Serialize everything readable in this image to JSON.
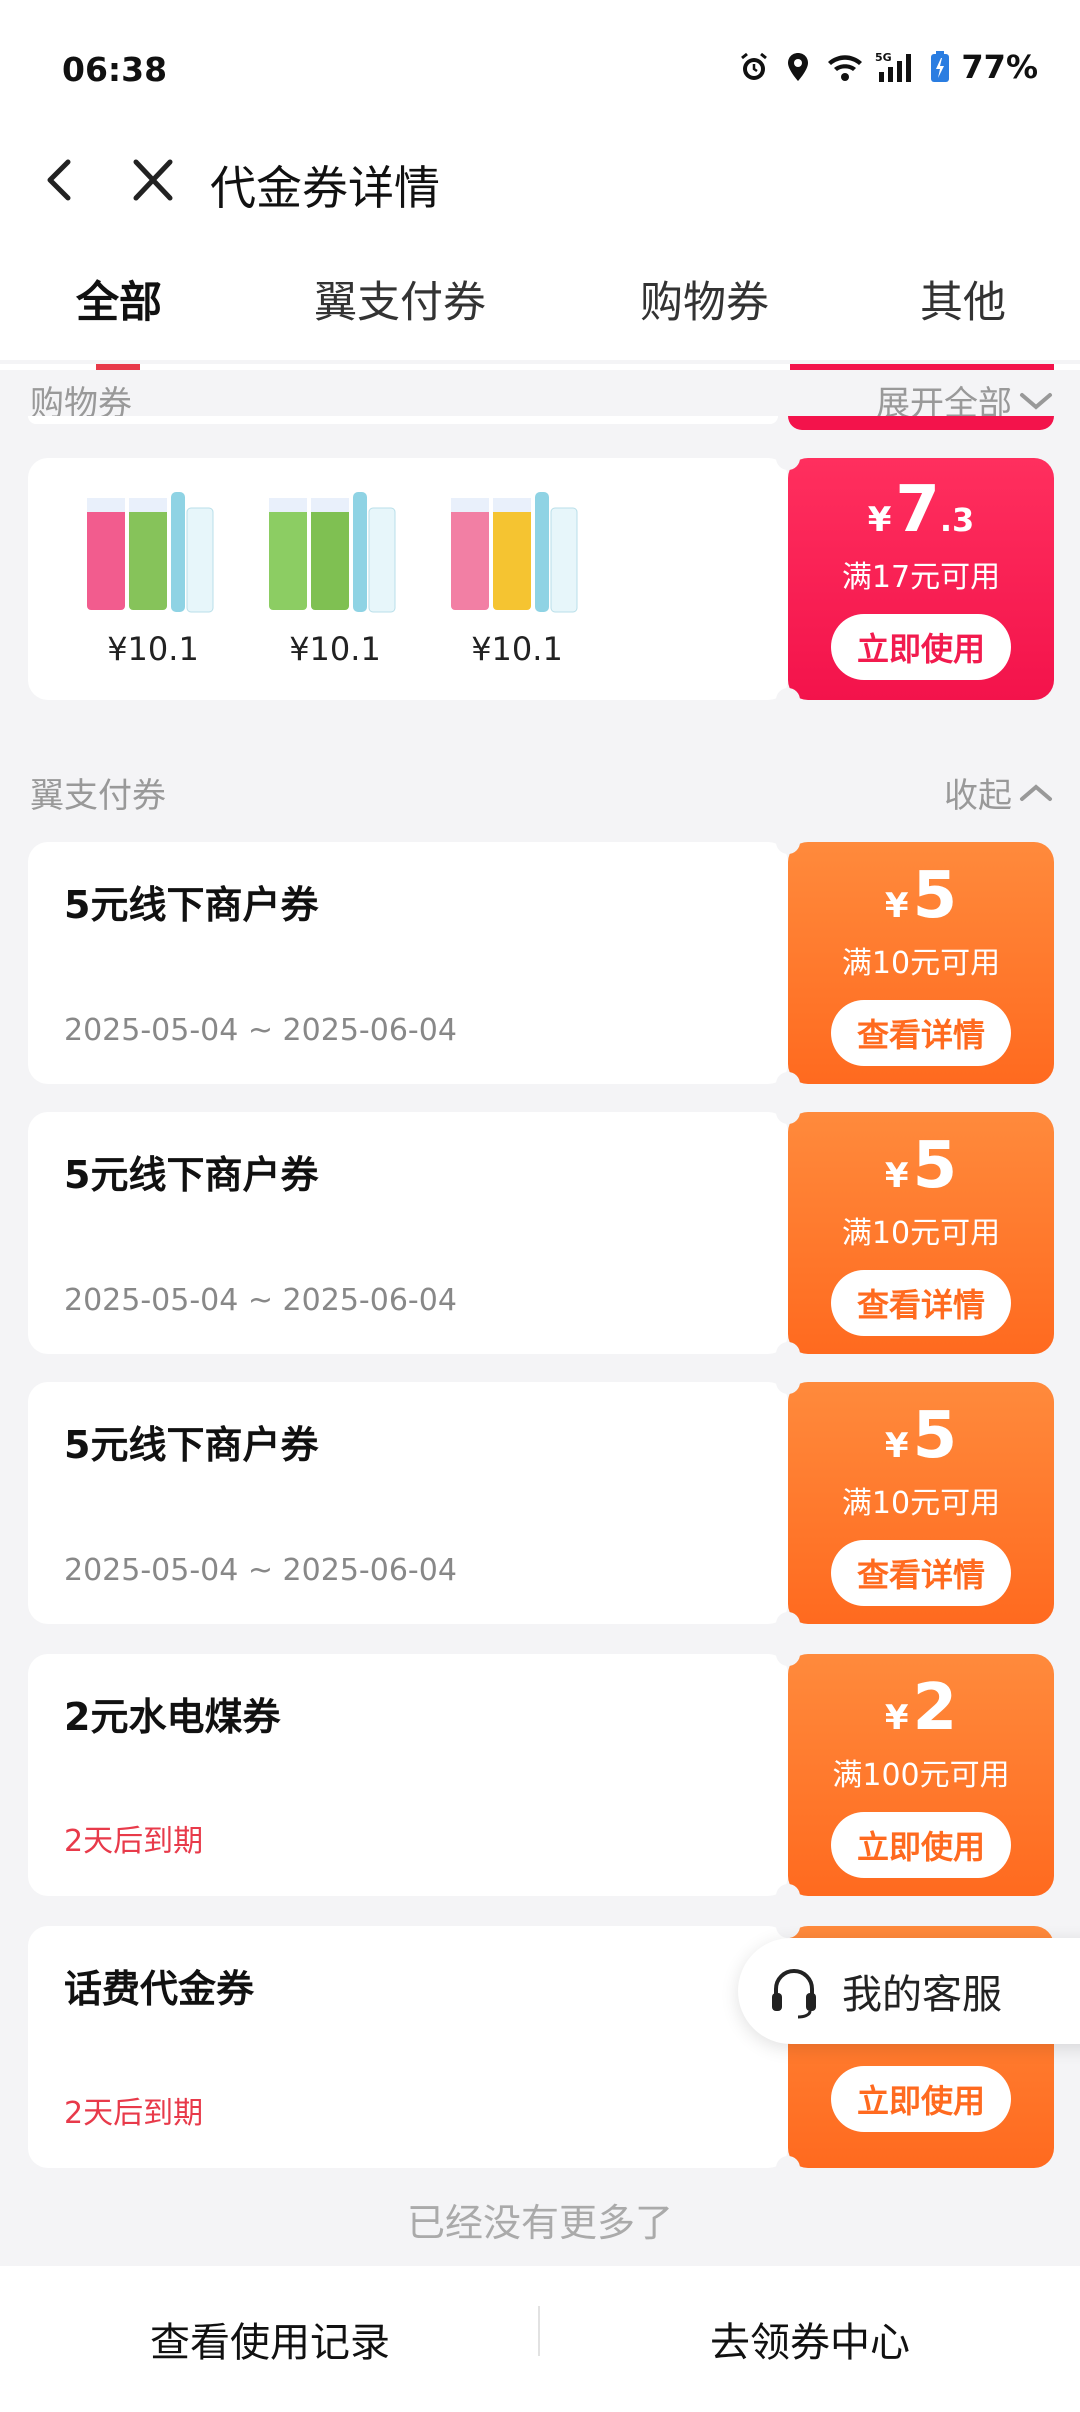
{
  "status": {
    "time": "06:38",
    "battery": "77%",
    "network": "5G"
  },
  "header": {
    "title": "代金券详情"
  },
  "tabs": [
    {
      "label": "全部",
      "active": true
    },
    {
      "label": "翼支付券",
      "active": false
    },
    {
      "label": "购物券",
      "active": false
    },
    {
      "label": "其他",
      "active": false
    }
  ],
  "shopping_section": {
    "label": "购物券",
    "action": "展开全部",
    "products": [
      {
        "price": "¥10.1"
      },
      {
        "price": "¥10.1"
      },
      {
        "price": "¥10.1"
      }
    ],
    "coupon": {
      "currency": "¥",
      "amount_int": "7",
      "amount_dec": ".3",
      "condition": "满17元可用",
      "button": "立即使用"
    }
  },
  "yzf_section": {
    "label": "翼支付券",
    "action": "收起",
    "coupons": [
      {
        "title": "5元线下商户券",
        "date": "2025-05-04 ~ 2025-06-04",
        "currency": "¥",
        "amount": "5",
        "condition": "满10元可用",
        "button": "查看详情"
      },
      {
        "title": "5元线下商户券",
        "date": "2025-05-04 ~ 2025-06-04",
        "currency": "¥",
        "amount": "5",
        "condition": "满10元可用",
        "button": "查看详情"
      },
      {
        "title": "5元线下商户券",
        "date": "2025-05-04 ~ 2025-06-04",
        "currency": "¥",
        "amount": "5",
        "condition": "满10元可用",
        "button": "查看详情"
      },
      {
        "title": "2元水电煤券",
        "date": "2天后到期",
        "currency": "¥",
        "amount": "2",
        "condition": "满100元可用",
        "button": "立即使用"
      },
      {
        "title": "话费代金券",
        "date": "2天后到期",
        "button": "立即使用"
      }
    ]
  },
  "no_more": "已经没有更多了",
  "service": {
    "label": "我的客服"
  },
  "bottom": {
    "left": "查看使用记录",
    "right": "去领券中心"
  },
  "colors": {
    "red": "#f3134b",
    "orange": "#ff6a1f",
    "warn": "#e83a4a"
  }
}
